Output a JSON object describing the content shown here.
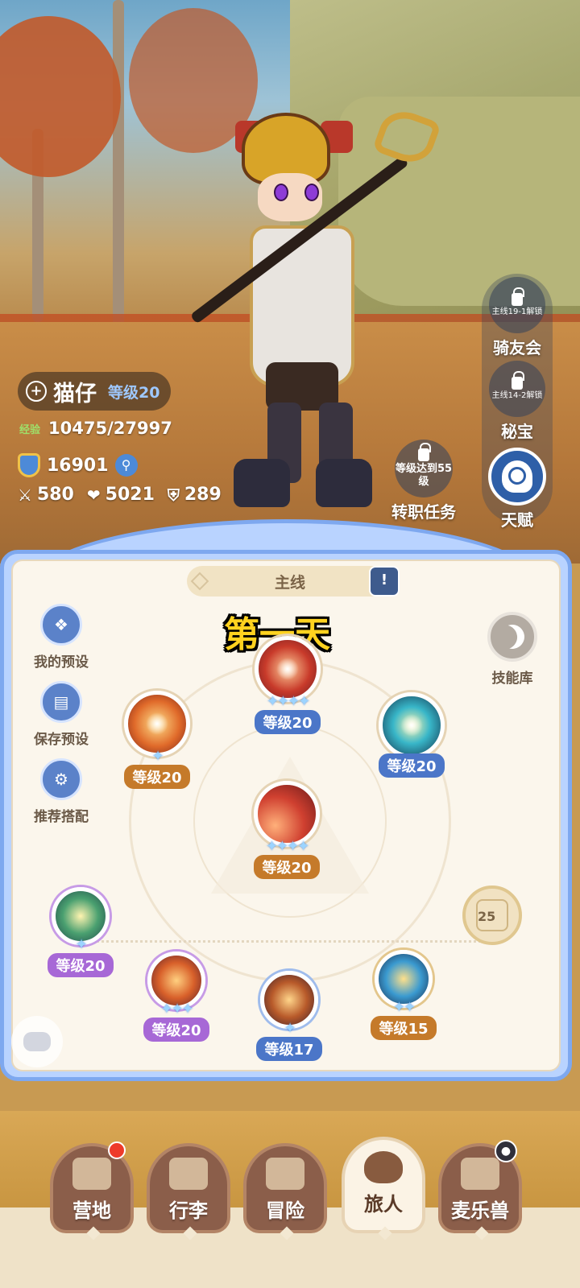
{
  "player": {
    "name": "猫仔",
    "level": "等级20",
    "exp_label": "经验",
    "exp": "10475/27997",
    "power": "16901",
    "attack": "580",
    "hp": "5021",
    "defense": "289"
  },
  "side_buttons": {
    "rider_lock": "主线19-1解锁",
    "rider_label": "骑友会",
    "treasure_lock": "主线14-2解锁",
    "treasure_label": "秘宝",
    "talent_label": "天赋"
  },
  "job": {
    "lock_text": "等级达到55级",
    "label": "转职任务"
  },
  "panel": {
    "tab": "主线",
    "overlay_title": "第一天",
    "skill_lib": "技能库",
    "tools": [
      "我的预设",
      "保存预设",
      "推荐搭配"
    ]
  },
  "skills": {
    "top": {
      "level": "等级20",
      "stars": "✦✦✦✦"
    },
    "left": {
      "level": "等级20",
      "stars": "✦"
    },
    "right": {
      "level": "等级20",
      "stars": ""
    },
    "center": {
      "level": "等级20",
      "stars": "✦✦✦✦"
    },
    "p1": {
      "level": "等级20",
      "stars": "✦"
    },
    "p2": {
      "level": "等级20",
      "stars": "✦✦✦"
    },
    "p3": {
      "level": "等级17",
      "stars": "✦"
    },
    "p4": {
      "level": "等级15",
      "stars": "✦✦"
    },
    "lock_level": "25"
  },
  "nav": [
    "营地",
    "行李",
    "冒险",
    "旅人",
    "麦乐兽"
  ],
  "colors": {
    "accent_blue": "#4b76c8",
    "accent_orange": "#c57a2a",
    "accent_purple": "#a768d6",
    "overlay_yellow": "#ffd21f"
  }
}
